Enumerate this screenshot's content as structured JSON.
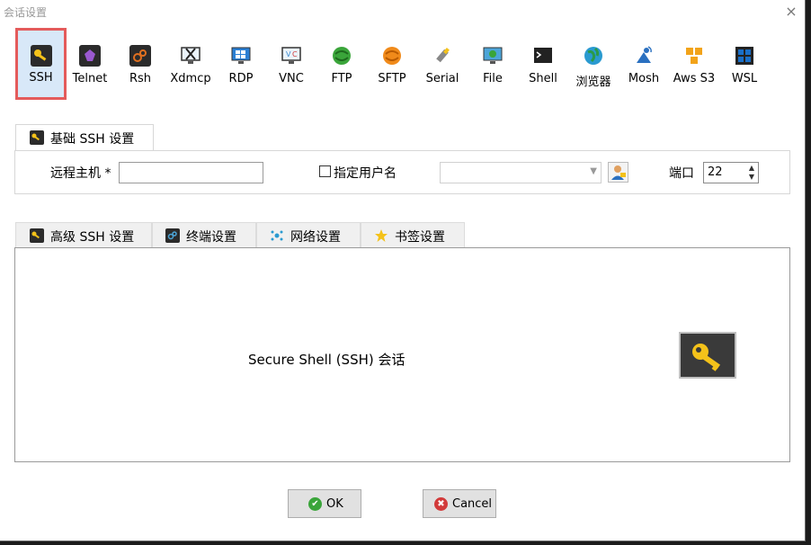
{
  "window": {
    "title": "会话设置",
    "close_icon": "×"
  },
  "protocols": [
    {
      "label": "SSH",
      "icon": "key-icon",
      "color": "#f4c21a",
      "selected": true
    },
    {
      "label": "Telnet",
      "icon": "telnet-icon",
      "color": "#9b59d0"
    },
    {
      "label": "Rsh",
      "icon": "rsh-icon",
      "color": "#e07020"
    },
    {
      "label": "Xdmcp",
      "icon": "xdmcp-icon",
      "color": "#555555"
    },
    {
      "label": "RDP",
      "icon": "rdp-icon",
      "color": "#2a7fd4"
    },
    {
      "label": "VNC",
      "icon": "vnc-icon",
      "color": "#3a8ad0"
    },
    {
      "label": "FTP",
      "icon": "ftp-icon",
      "color": "#3aa53a"
    },
    {
      "label": "SFTP",
      "icon": "sftp-icon",
      "color": "#f08a1a"
    },
    {
      "label": "Serial",
      "icon": "serial-icon",
      "color": "#888888"
    },
    {
      "label": "File",
      "icon": "file-icon",
      "color": "#4ca5d8"
    },
    {
      "label": "Shell",
      "icon": "shell-icon",
      "color": "#222222"
    },
    {
      "label": "浏览器",
      "icon": "browser-icon",
      "color": "#2a9a4a"
    },
    {
      "label": "Mosh",
      "icon": "mosh-icon",
      "color": "#2a70c0"
    },
    {
      "label": "Aws S3",
      "icon": "aws-s3-icon",
      "color": "#f2a31a"
    },
    {
      "label": "WSL",
      "icon": "wsl-icon",
      "color": "#1a6fc8"
    }
  ],
  "basic": {
    "tab_label": "基础 SSH 设置",
    "host_label": "远程主机 *",
    "host_value": "",
    "user_label": "指定用户名",
    "user_checked": false,
    "user_value": "",
    "port_label": "端口",
    "port_value": "22"
  },
  "advanced_tabs": [
    {
      "label": "高级 SSH 设置",
      "icon": "key-icon"
    },
    {
      "label": "终端设置",
      "icon": "terminal-settings-icon"
    },
    {
      "label": "网络设置",
      "icon": "network-icon"
    },
    {
      "label": "书签设置",
      "icon": "star-icon"
    }
  ],
  "content": {
    "description": "Secure Shell (SSH) 会话"
  },
  "buttons": {
    "ok": "OK",
    "cancel": "Cancel"
  },
  "colors": {
    "accent": "#e45b5b",
    "selected_bg": "#d8e8f8",
    "key": "#f4c21a"
  }
}
